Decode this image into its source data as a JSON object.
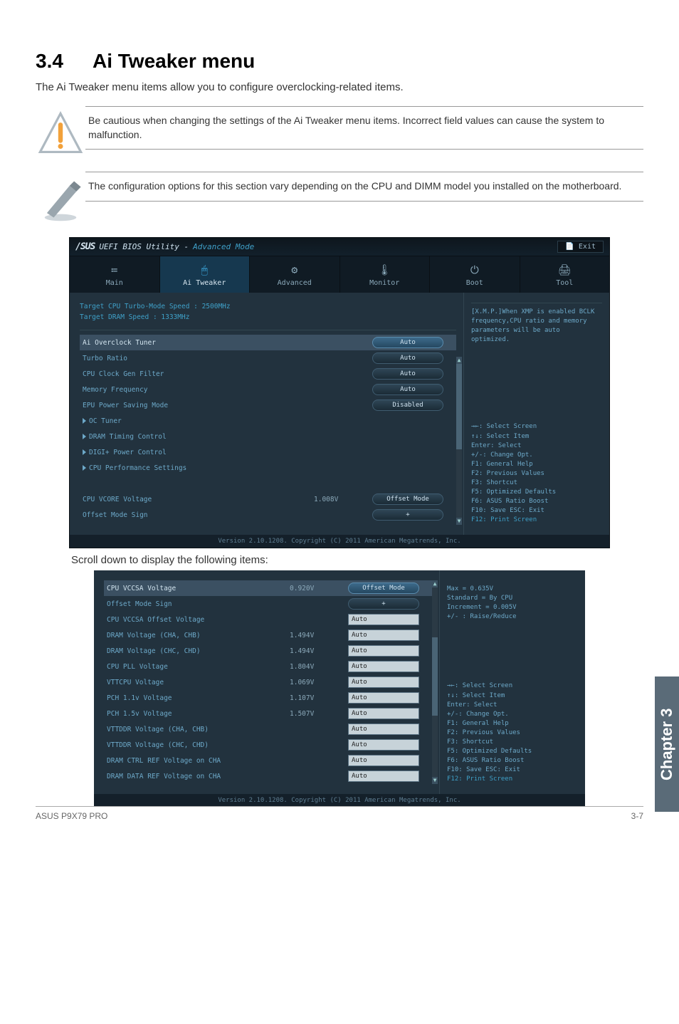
{
  "doc": {
    "section_number": "3.4",
    "section_title": "Ai Tweaker menu",
    "lead": "The Ai Tweaker menu items allow you to configure overclocking-related items.",
    "caution": "Be cautious when changing the settings of the Ai Tweaker menu items. Incorrect field values can cause the system to malfunction.",
    "note": "The configuration options for this section vary depending on the CPU and DIMM model you installed on the motherboard.",
    "scroll_note": "Scroll down to display the following items:",
    "chapter_tab": "Chapter 3",
    "footer_left": "ASUS P9X79 PRO",
    "footer_right": "3-7"
  },
  "bios": {
    "logo": "/SUS",
    "title_a": "UEFI BIOS Utility - ",
    "title_b": "Advanced Mode",
    "exit": "Exit",
    "tabs": [
      {
        "icon": "≔",
        "label": "Main"
      },
      {
        "icon": "🖱",
        "label": "Ai Tweaker"
      },
      {
        "icon": "⚙",
        "label": "Advanced"
      },
      {
        "icon": "🌡",
        "label": "Monitor"
      },
      {
        "icon": "⏻",
        "label": "Boot"
      },
      {
        "icon": "🖨",
        "label": "Tool"
      }
    ],
    "targets": [
      "Target CPU Turbo-Mode Speed : 2500MHz",
      "Target DRAM Speed : 1333MHz"
    ],
    "rows": [
      {
        "label": "Ai Overclock Tuner",
        "type": "pill",
        "value": "Auto",
        "selected": true
      },
      {
        "label": "Turbo Ratio",
        "type": "pill",
        "value": "Auto"
      },
      {
        "label": "CPU Clock Gen Filter",
        "type": "pill",
        "value": "Auto"
      },
      {
        "label": "Memory Frequency",
        "type": "pill",
        "value": "Auto"
      },
      {
        "label": "EPU Power Saving Mode",
        "type": "pill",
        "value": "Disabled"
      },
      {
        "label": "OC Tuner",
        "type": "submenu"
      },
      {
        "label": "DRAM Timing Control",
        "type": "submenu"
      },
      {
        "label": "DIGI+ Power Control",
        "type": "submenu"
      },
      {
        "label": "CPU Performance Settings",
        "type": "submenu"
      },
      {
        "label": "",
        "type": "blank"
      },
      {
        "label": "CPU VCORE Voltage",
        "current": "1.008V",
        "type": "pill",
        "value": "Offset Mode"
      },
      {
        "label": "Offset Mode Sign",
        "type": "pill",
        "value": "+"
      }
    ],
    "help": "[X.M.P.]When XMP is enabled BCLK frequency,CPU ratio and memory parameters will be auto optimized.",
    "keys": "→←: Select Screen\n↑↓: Select Item\nEnter: Select\n+/-: Change Opt.\nF1: General Help\nF2: Previous Values\nF3: Shortcut\nF5: Optimized Defaults\nF6: ASUS Ratio Boost\nF10: Save  ESC: Exit",
    "keys_last": "F12: Print Screen",
    "copyright": "Version 2.10.1208. Copyright (C) 2011 American Megatrends, Inc."
  },
  "bios2": {
    "rows": [
      {
        "label": "CPU VCCSA Voltage",
        "current": "0.920V",
        "type": "pill",
        "value": "Offset Mode",
        "selected": true
      },
      {
        "label": "Offset Mode Sign",
        "type": "pill",
        "value": "+"
      },
      {
        "label": "  CPU VCCSA Offset Voltage",
        "type": "input",
        "value": "Auto"
      },
      {
        "label": "DRAM Voltage (CHA, CHB)",
        "current": "1.494V",
        "type": "input",
        "value": "Auto"
      },
      {
        "label": "DRAM Voltage (CHC, CHD)",
        "current": "1.494V",
        "type": "input",
        "value": "Auto"
      },
      {
        "label": "CPU PLL Voltage",
        "current": "1.804V",
        "type": "input",
        "value": "Auto"
      },
      {
        "label": "VTTCPU Voltage",
        "current": "1.069V",
        "type": "input",
        "value": "Auto"
      },
      {
        "label": "PCH 1.1v Voltage",
        "current": "1.107V",
        "type": "input",
        "value": "Auto"
      },
      {
        "label": "PCH 1.5v Voltage",
        "current": "1.507V",
        "type": "input",
        "value": "Auto"
      },
      {
        "label": "VTTDDR Voltage (CHA, CHB)",
        "type": "input",
        "value": "Auto"
      },
      {
        "label": "VTTDDR Voltage (CHC, CHD)",
        "type": "input",
        "value": "Auto"
      },
      {
        "label": "DRAM CTRL REF Voltage on CHA",
        "type": "input",
        "value": "Auto"
      },
      {
        "label": "DRAM DATA REF Voltage on CHA",
        "type": "input",
        "value": "Auto"
      }
    ],
    "help": "Max = 0.635V\nStandard = By CPU\nIncrement = 0.005V\n+/- : Raise/Reduce",
    "keys": "→←: Select Screen\n↑↓: Select Item\nEnter: Select\n+/-: Change Opt.\nF1: General Help\nF2: Previous Values\nF3: Shortcut\nF5: Optimized Defaults\nF6: ASUS Ratio Boost\nF10: Save  ESC: Exit",
    "keys_last": "F12: Print Screen"
  }
}
